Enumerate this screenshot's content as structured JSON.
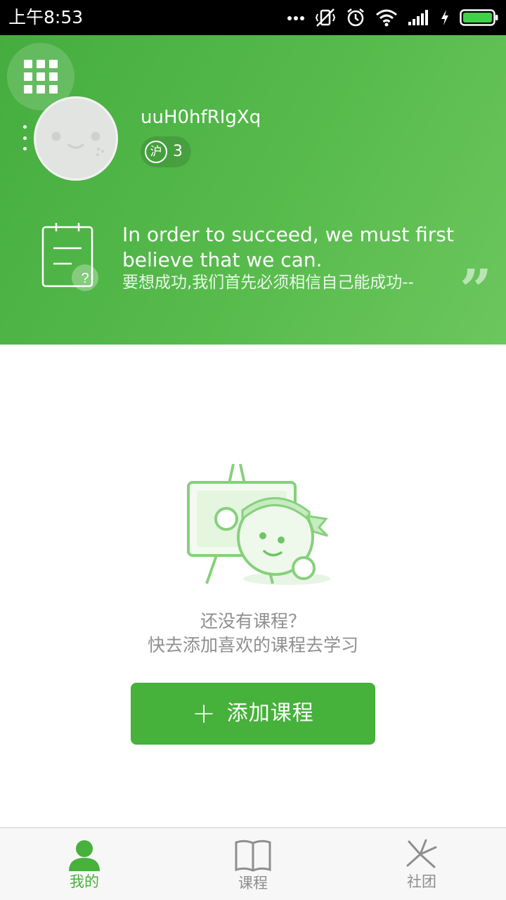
{
  "status_bar": {
    "time": "上午8:53",
    "icons": [
      "more-dots-icon",
      "vibrate-off-icon",
      "alarm-icon",
      "wifi-icon",
      "signal-icon",
      "charging-icon",
      "battery-icon"
    ]
  },
  "profile": {
    "username": "uuH0hfRIgXq",
    "region_badge": "沪",
    "level": "3"
  },
  "quote": {
    "english": "In order to succeed, we must first believe that we can.",
    "chinese": "要想成功,我们首先必须相信自己能成功--",
    "mark": "”"
  },
  "empty_state": {
    "line1": "还没有课程？",
    "line2": "快去添加喜欢的课程去学习"
  },
  "add_course_button": {
    "plus": "+",
    "label": "添加课程"
  },
  "bottom_nav": {
    "items": [
      {
        "label": "我的",
        "icon": "person-icon",
        "active": true
      },
      {
        "label": "课程",
        "icon": "book-icon",
        "active": false
      },
      {
        "label": "社团",
        "icon": "community-icon",
        "active": false
      }
    ]
  },
  "colors": {
    "primary_green": "#46b13b",
    "header_green_start": "#45ad3f",
    "header_green_end": "#6cc65e",
    "muted_text": "#8f8f8f"
  }
}
